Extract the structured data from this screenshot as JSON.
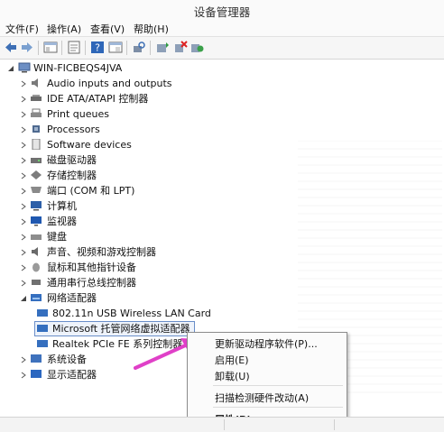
{
  "window": {
    "title": "设备管理器"
  },
  "menu": [
    "文件(F)",
    "操作(A)",
    "查看(V)",
    "帮助(H)"
  ],
  "toolbar": {
    "buttons": [
      "back-icon",
      "forward-icon",
      "show-hide-tree-icon",
      "properties-icon",
      "help-icon",
      "console-icon",
      "scan-hardware-icon",
      "update-driver-icon",
      "disable-icon",
      "uninstall-icon"
    ]
  },
  "tree": {
    "root": "WIN-FICBEQS4JVA",
    "items": [
      {
        "label": "Audio inputs and outputs",
        "icon": "speaker-icon"
      },
      {
        "label": "IDE ATA/ATAPI 控制器",
        "icon": "ide-controller-icon"
      },
      {
        "label": "Print queues",
        "icon": "printer-icon"
      },
      {
        "label": "Processors",
        "icon": "processor-icon"
      },
      {
        "label": "Software devices",
        "icon": "software-device-icon"
      },
      {
        "label": "磁盘驱动器",
        "icon": "disk-drive-icon"
      },
      {
        "label": "存储控制器",
        "icon": "storage-controller-icon"
      },
      {
        "label": "端口 (COM 和 LPT)",
        "icon": "port-icon"
      },
      {
        "label": "计算机",
        "icon": "computer-icon"
      },
      {
        "label": "监视器",
        "icon": "monitor-icon"
      },
      {
        "label": "键盘",
        "icon": "keyboard-icon"
      },
      {
        "label": "声音、视频和游戏控制器",
        "icon": "sound-icon"
      },
      {
        "label": "鼠标和其他指针设备",
        "icon": "mouse-icon"
      },
      {
        "label": "通用串行总线控制器",
        "icon": "usb-icon"
      },
      {
        "label": "网络适配器",
        "icon": "network-adapter-icon"
      }
    ],
    "network_children": [
      {
        "label": "802.11n USB Wireless LAN Card"
      },
      {
        "label": "Microsoft 托管网络虚拟适配器"
      },
      {
        "label": "Realtek PCIe FE 系列控制器"
      }
    ],
    "after": [
      {
        "label": "系统设备",
        "icon": "system-device-icon"
      },
      {
        "label": "显示适配器",
        "icon": "display-adapter-icon"
      }
    ]
  },
  "context_menu": {
    "items": [
      "更新驱动程序软件(P)...",
      "启用(E)",
      "卸载(U)",
      "扫描检测硬件改动(A)",
      "属性(R)"
    ]
  },
  "colors": {
    "arrow": "#e040c8",
    "selection_border": "#6a8ec9",
    "selection_fill": "#eef3fb"
  }
}
